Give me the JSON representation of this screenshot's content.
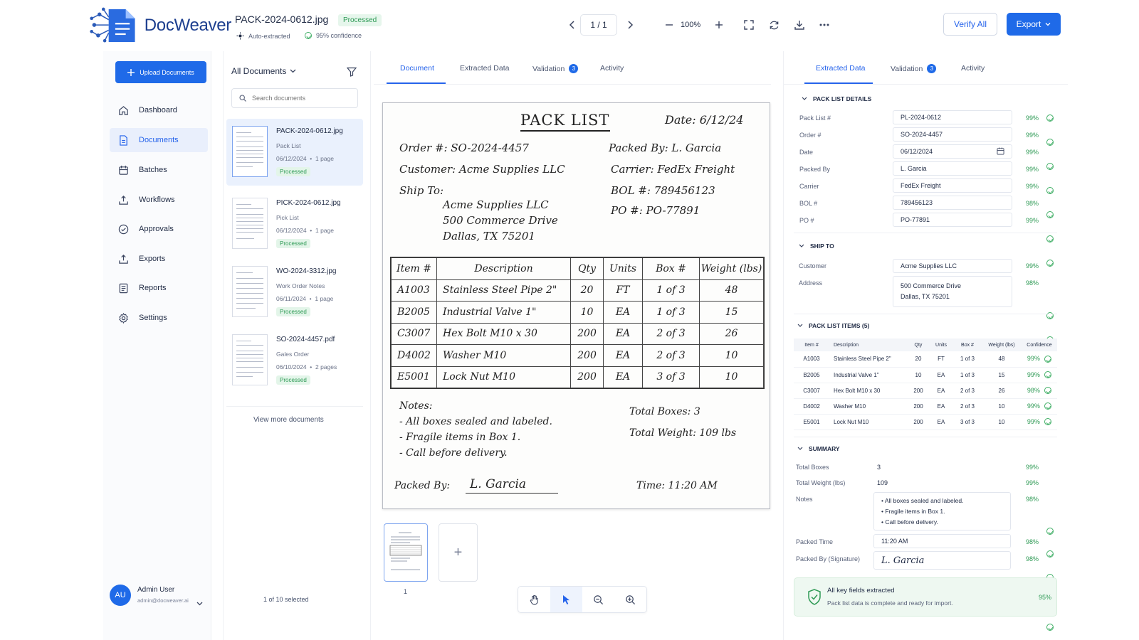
{
  "brand": {
    "name": "DocWeaver"
  },
  "header": {
    "file_name": "PACK-2024-0612.jpg",
    "status": "Processed",
    "auto_extracted": "Auto-extracted",
    "confidence": "95% confidence",
    "page_indicator": "1 / 1",
    "zoom": "100%",
    "verify_all": "Verify All",
    "export": "Export"
  },
  "sidebar": {
    "upload": "Upload Documents",
    "items": [
      {
        "label": "Dashboard",
        "icon": "home-icon"
      },
      {
        "label": "Documents",
        "icon": "document-icon",
        "active": true
      },
      {
        "label": "Batches",
        "icon": "batches-icon"
      },
      {
        "label": "Workflows",
        "icon": "workflows-icon"
      },
      {
        "label": "Approvals",
        "icon": "approvals-icon"
      },
      {
        "label": "Exports",
        "icon": "exports-icon"
      },
      {
        "label": "Reports",
        "icon": "reports-icon"
      },
      {
        "label": "Settings",
        "icon": "settings-icon"
      }
    ],
    "user": {
      "initials": "AU",
      "name": "Admin User",
      "email": "admin@docweaver.ai"
    }
  },
  "doclist": {
    "filter_label": "All Documents",
    "search_placeholder": "Search documents",
    "documents": [
      {
        "name": "PACK-2024-0612.jpg",
        "type": "Pack List",
        "date": "06/12/2024",
        "pages": "1 page",
        "status": "Processed",
        "active": true
      },
      {
        "name": "PICK-2024-0612.jpg",
        "type": "Pick List",
        "date": "06/12/2024",
        "pages": "1 page",
        "status": "Processed"
      },
      {
        "name": "WO-2024-3312.jpg",
        "type": "Work Order Notes",
        "date": "06/11/2024",
        "pages": "1 page",
        "status": "Processed"
      },
      {
        "name": "SO-2024-4457.pdf",
        "type": "Gales Order",
        "date": "06/10/2024",
        "pages": "2 pages",
        "status": "Processed"
      }
    ],
    "view_more": "View more documents",
    "selected_count": "1 of 10 selected"
  },
  "center": {
    "tabs": [
      {
        "label": "Document",
        "active": true
      },
      {
        "label": "Extracted Data"
      },
      {
        "label": "Validation",
        "count": "3"
      },
      {
        "label": "Activity"
      }
    ],
    "thumb_page": "1",
    "add_page": "+"
  },
  "paper": {
    "title": "PACK LIST",
    "date": "Date: 6/12/24",
    "order": "Order #: SO-2024-4457",
    "packed_by_top": "Packed By: L. Garcia",
    "customer": "Customer: Acme Supplies LLC",
    "carrier": "Carrier: FedEx Freight",
    "ship_to_label": "Ship To:",
    "ship_to_1": "Acme Supplies LLC",
    "ship_to_2": "500 Commerce Drive",
    "ship_to_3": "Dallas, TX 75201",
    "bol": "BOL #: 789456123",
    "po": "PO #: PO-77891",
    "table_headers": [
      "Item #",
      "Description",
      "Qty",
      "Units",
      "Box #",
      "Weight (lbs)"
    ],
    "rows": [
      [
        "A1003",
        "Stainless Steel Pipe 2\"",
        "20",
        "FT",
        "1 of 3",
        "48"
      ],
      [
        "B2005",
        "Industrial Valve 1\"",
        "10",
        "EA",
        "1 of 3",
        "15"
      ],
      [
        "C3007",
        "Hex Bolt M10 x 30",
        "200",
        "EA",
        "2 of 3",
        "26"
      ],
      [
        "D4002",
        "Washer M10",
        "200",
        "EA",
        "2 of 3",
        "10"
      ],
      [
        "E5001",
        "Lock Nut M10",
        "200",
        "EA",
        "3 of 3",
        "10"
      ]
    ],
    "notes_label": "Notes:",
    "notes": [
      "- All boxes sealed and labeled.",
      "- Fragile items in Box 1.",
      "- Call before delivery."
    ],
    "total_boxes": "Total Boxes: 3",
    "total_weight": "Total Weight: 109 lbs",
    "packed_by_label": "Packed By:",
    "signature": "L. Garcia",
    "time": "Time: 11:20 AM"
  },
  "right": {
    "tabs": [
      {
        "label": "Extracted Data",
        "active": true
      },
      {
        "label": "Validation",
        "count": "3"
      },
      {
        "label": "Activity"
      }
    ],
    "details_head": "PACK LIST DETAILS",
    "details": [
      {
        "label": "Pack List #",
        "value": "PL-2024-0612",
        "conf": "99%"
      },
      {
        "label": "Order #",
        "value": "SO-2024-4457",
        "conf": "99%"
      },
      {
        "label": "Date",
        "value": "06/12/2024",
        "conf": "99%"
      },
      {
        "label": "Packed By",
        "value": "L. Garcia",
        "conf": "99%"
      },
      {
        "label": "Carrier",
        "value": "FedEx Freight",
        "conf": "99%"
      },
      {
        "label": "BOL #",
        "value": "789456123",
        "conf": "98%"
      },
      {
        "label": "PO #",
        "value": "PO-77891",
        "conf": "99%"
      }
    ],
    "ship_head": "SHIP TO",
    "customer_label": "Customer",
    "customer_value": "Acme Supplies LLC",
    "customer_conf": "99%",
    "address_label": "Address",
    "address_line1": "500 Commerce Drive",
    "address_line2": "Dallas, TX 75201",
    "address_conf": "98%",
    "items_head": "PACK LIST ITEMS (5)",
    "items_headers": [
      "Item #",
      "Description",
      "Qty",
      "Units",
      "Box #",
      "Weight (lbs)",
      "Confidence"
    ],
    "items": [
      [
        "A1003",
        "Stainless Steel Pipe 2\"",
        "20",
        "FT",
        "1 of 3",
        "48",
        "99%"
      ],
      [
        "B2005",
        "Industrial Valve 1\"",
        "10",
        "EA",
        "1 of 3",
        "15",
        "99%"
      ],
      [
        "C3007",
        "Hex Bolt M10 x 30",
        "200",
        "EA",
        "2 of 3",
        "26",
        "98%"
      ],
      [
        "D4002",
        "Washer M10",
        "200",
        "EA",
        "2 of 3",
        "10",
        "99%"
      ],
      [
        "E5001",
        "Lock Nut M10",
        "200",
        "EA",
        "3 of 3",
        "10",
        "99%"
      ]
    ],
    "summary_head": "SUMMARY",
    "total_boxes_label": "Total Boxes",
    "total_boxes": "3",
    "total_boxes_conf": "99%",
    "total_weight_label": "Total Weight (lbs)",
    "total_weight": "109",
    "total_weight_conf": "99%",
    "notes_label": "Notes",
    "notes": [
      "• All boxes sealed and labeled.",
      "• Fragile items in Box 1.",
      "• Call before delivery."
    ],
    "notes_conf": "98%",
    "packed_time_label": "Packed Time",
    "packed_time": "11:20 AM",
    "packed_time_conf": "98%",
    "signature_label": "Packed By (Signature)",
    "signature": "L. Garcia",
    "signature_conf": "98%",
    "banner_title": "All key fields extracted",
    "banner_text": "Pack list data is complete and ready for import.",
    "banner_conf": "95%"
  },
  "colors": {
    "accent": "#1f6ae8",
    "success": "#2e9a55",
    "text": "#1f2a44"
  }
}
